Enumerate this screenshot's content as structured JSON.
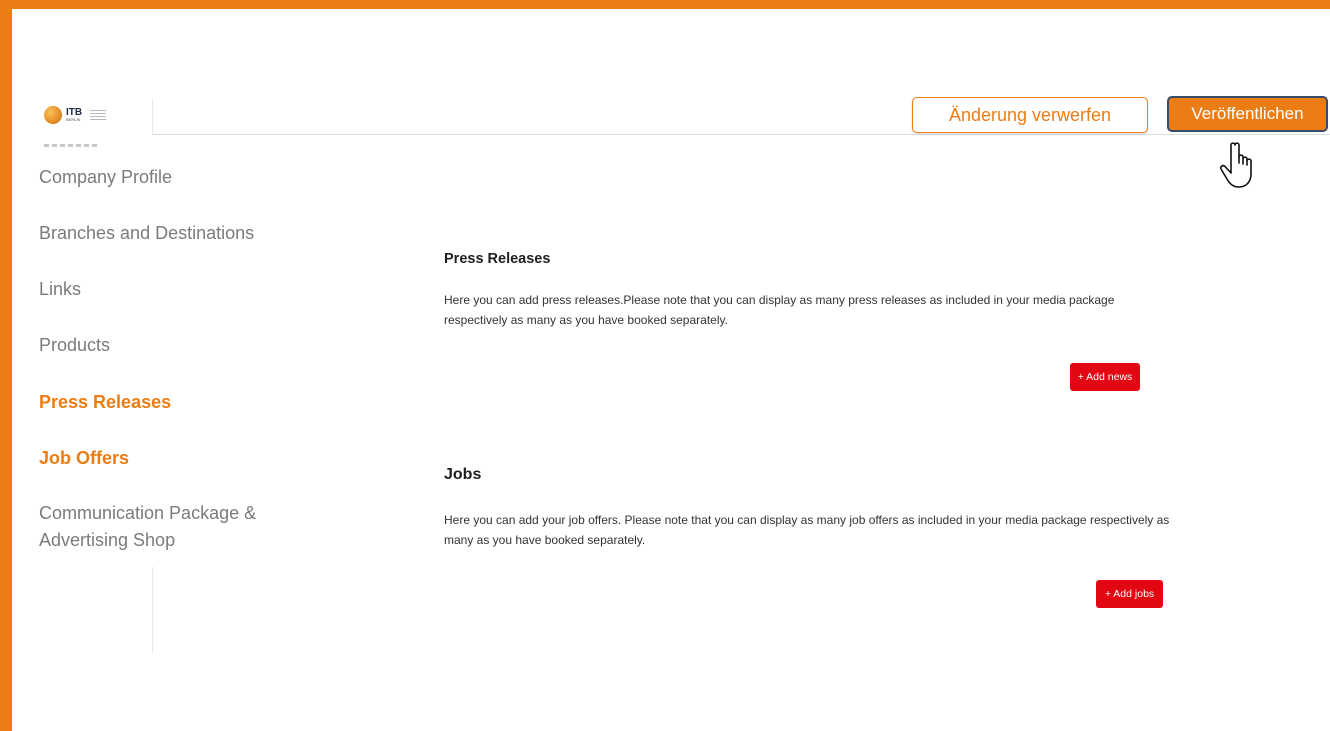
{
  "header": {
    "logo_brand": "ITB",
    "logo_sub": "BERLIN",
    "discard_label": "Änderung verwerfen",
    "publish_label": "Veröffentlichen"
  },
  "sidebar": {
    "items": [
      {
        "label": "Company Profile",
        "active": false
      },
      {
        "label": "Branches and Destinations",
        "active": false
      },
      {
        "label": "Links",
        "active": false
      },
      {
        "label": "Products",
        "active": false
      },
      {
        "label": "Press Releases",
        "active": true
      },
      {
        "label": "Job Offers",
        "active": true
      },
      {
        "label": "Communication Package & Advertising Shop",
        "active": false
      }
    ]
  },
  "main": {
    "press": {
      "title": "Press Releases",
      "description": "Here you can add press releases.Please note that you can display as many press releases as included in your media package respectively as many as you have booked separately.",
      "button_label": "+ Add news"
    },
    "jobs": {
      "title": "Jobs",
      "description": "Here you can add your job offers. Please note that you can display as many job offers as included in your media package respectively as many as you have booked separately.",
      "button_label": "+ Add jobs"
    }
  },
  "colors": {
    "accent": "#EC7D14",
    "action_red": "#E30613",
    "nav_text": "#7B7B7B"
  },
  "icons": {
    "cursor": "pointer-hand-icon",
    "logo": "globe-icon"
  }
}
